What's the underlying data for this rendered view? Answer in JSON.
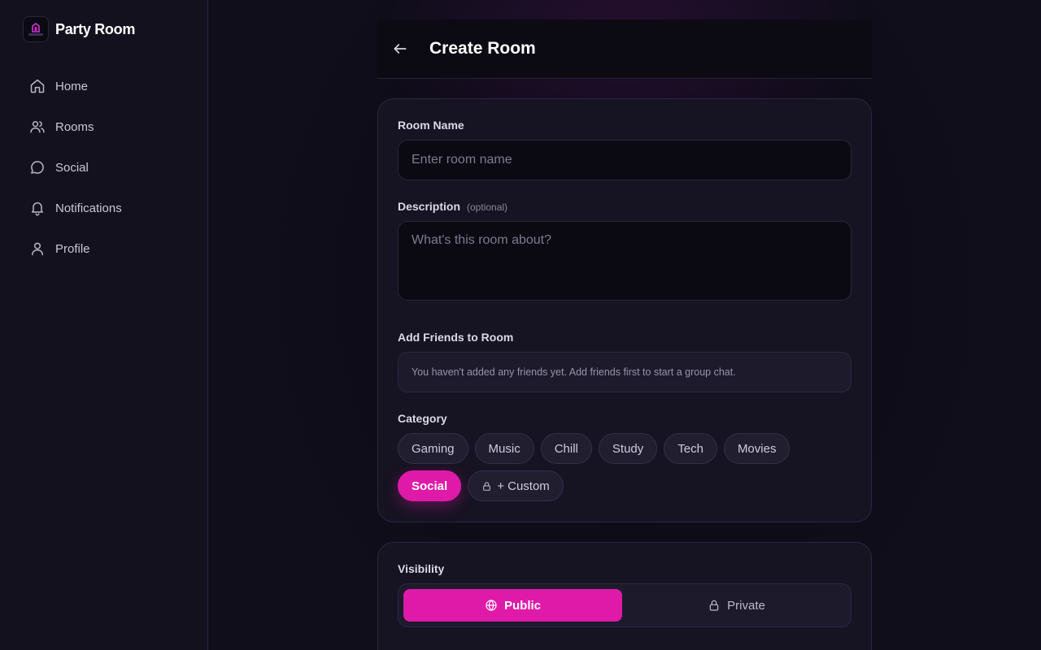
{
  "app": {
    "name": "Party Room",
    "logo_text": "Party Room",
    "accent_color": "#e01aa8"
  },
  "sidebar": {
    "items": [
      {
        "label": "Home",
        "icon": "home-icon"
      },
      {
        "label": "Rooms",
        "icon": "users-icon"
      },
      {
        "label": "Social",
        "icon": "chat-icon"
      },
      {
        "label": "Notifications",
        "icon": "bell-icon"
      },
      {
        "label": "Profile",
        "icon": "user-icon"
      }
    ]
  },
  "header": {
    "title": "Create Room",
    "back_icon": "arrow-left-icon"
  },
  "form": {
    "room_name": {
      "label": "Room Name",
      "placeholder": "Enter room name",
      "value": ""
    },
    "description": {
      "label": "Description",
      "optional": "(optional)",
      "placeholder": "What's this room about?",
      "value": ""
    },
    "friends": {
      "label": "Add Friends to Room",
      "empty_text": "You haven't added any friends yet. Add friends first to start a group chat."
    },
    "category": {
      "label": "Category",
      "options": [
        "Gaming",
        "Music",
        "Chill",
        "Study",
        "Tech",
        "Movies",
        "Social"
      ],
      "selected": "Social",
      "custom_label": "+ Custom"
    },
    "visibility": {
      "label": "Visibility",
      "options": [
        {
          "label": "Public",
          "icon": "globe-icon"
        },
        {
          "label": "Private",
          "icon": "lock-icon"
        }
      ],
      "selected": "Public"
    }
  }
}
